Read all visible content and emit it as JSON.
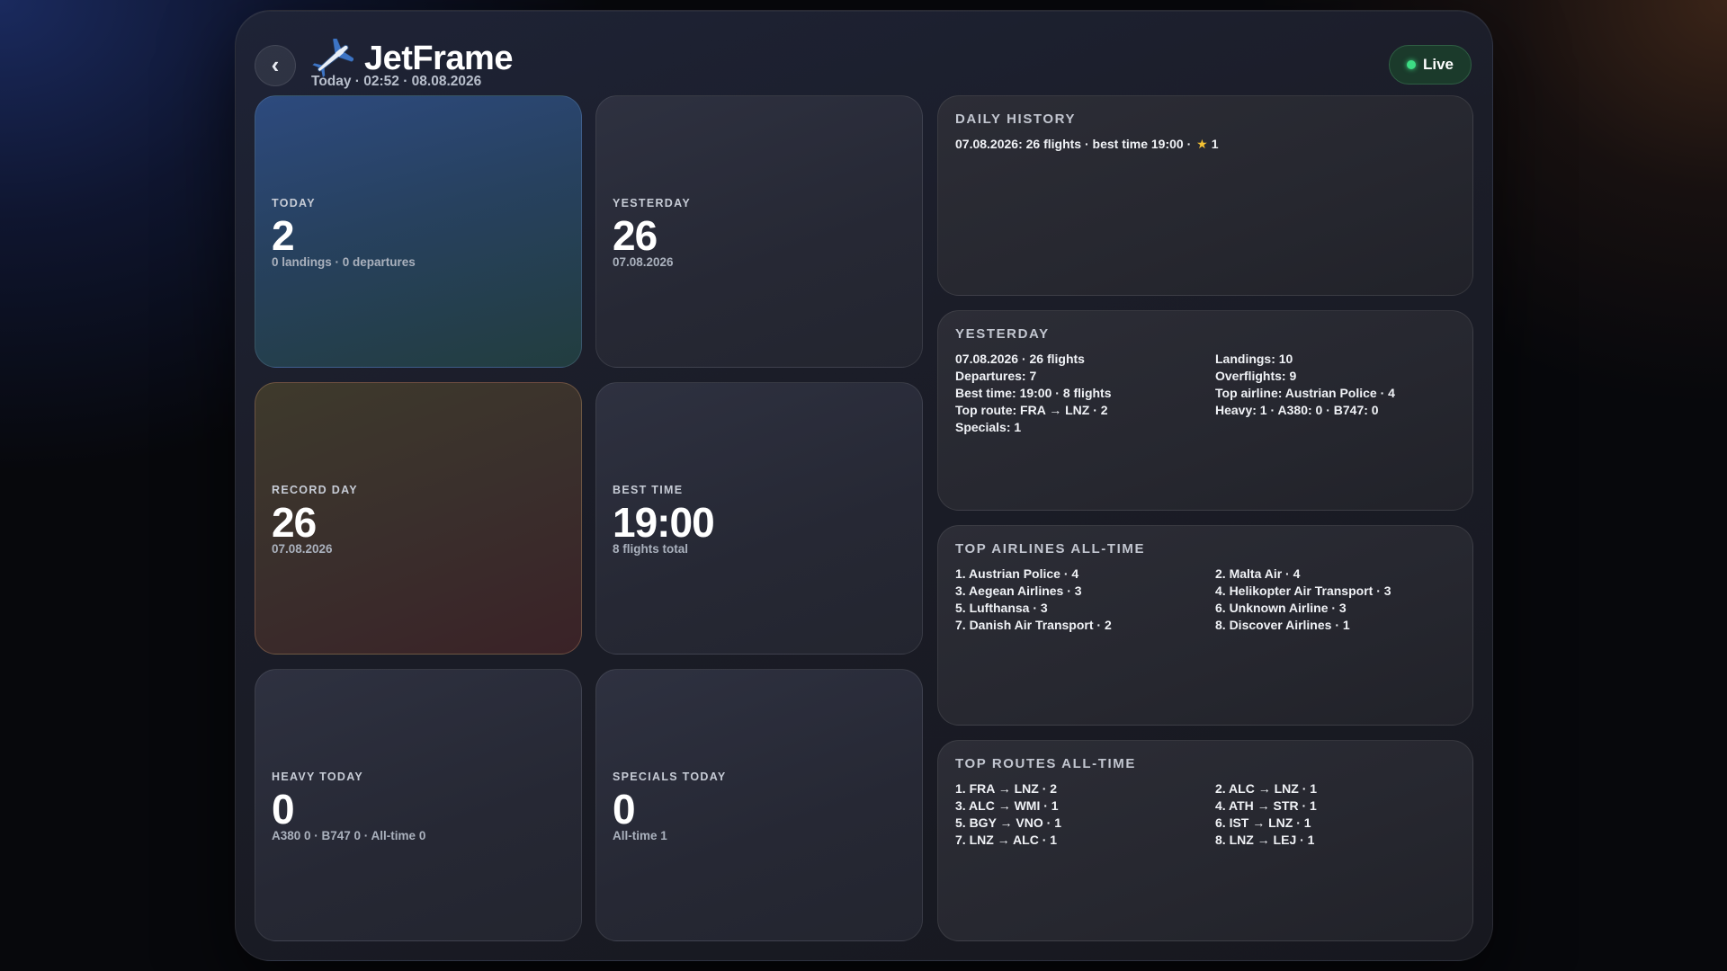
{
  "header": {
    "app_title": "JetFrame",
    "subtitle": "Today · 02:52 · 08.08.2026",
    "back_symbol": "‹",
    "live_label": "Live",
    "icons": {
      "back": "chevron-left-icon",
      "logo": "airplane-icon",
      "live": "status-dot-icon"
    },
    "colors": {
      "live_dot": "#3ddc84",
      "live_bg": "#1b3a2b"
    }
  },
  "tiles": {
    "today": {
      "label": "TODAY",
      "value": "2",
      "sub": "0 landings · 0 departures"
    },
    "yesterday": {
      "label": "YESTERDAY",
      "value": "26",
      "sub": "07.08.2026"
    },
    "record_day": {
      "label": "RECORD DAY",
      "value": "26",
      "sub": "07.08.2026"
    },
    "best_time": {
      "label": "BEST TIME",
      "value": "19:00",
      "sub": "8 flights total"
    },
    "heavy_today": {
      "label": "HEAVY TODAY",
      "value": "0",
      "sub": "A380 0 · B747 0 · All-time 0"
    },
    "specials_today": {
      "label": "SPECIALS TODAY",
      "value": "0",
      "sub": "All-time 1"
    }
  },
  "daily_history": {
    "title": "DAILY HISTORY",
    "entry_text": "07.08.2026: 26 flights · best time 19:00 ·",
    "star": "★",
    "star_count": "1"
  },
  "yesterday_panel": {
    "title": "YESTERDAY",
    "left": [
      "07.08.2026 · 26 flights",
      "Departures: 7",
      "Best time: 19:00 · 8 flights",
      "Top route: FRA → LNZ · 2",
      "Specials: 1"
    ],
    "right": [
      "Landings: 10",
      "Overflights: 9",
      "Top airline: Austrian Police · 4",
      "Heavy: 1 · A380: 0 · B747: 0"
    ]
  },
  "top_airlines": {
    "title": "TOP AIRLINES ALL-TIME",
    "left": [
      "1. Austrian Police · 4",
      "3. Aegean Airlines · 3",
      "5. Lufthansa · 3",
      "7. Danish Air Transport · 2"
    ],
    "right": [
      "2. Malta Air · 4",
      "4. Helikopter Air Transport · 3",
      "6. Unknown Airline · 3",
      "8. Discover Airlines · 1"
    ]
  },
  "top_routes": {
    "title": "TOP ROUTES ALL-TIME",
    "left": [
      "1. FRA → LNZ · 2",
      "3. ALC → WMI · 1",
      "5. BGY → VNO · 1",
      "7. LNZ → ALC · 1"
    ],
    "right": [
      "2. ALC → LNZ · 1",
      "4. ATH → STR · 1",
      "6. IST → LNZ · 1",
      "8. LNZ → LEJ · 1"
    ]
  }
}
